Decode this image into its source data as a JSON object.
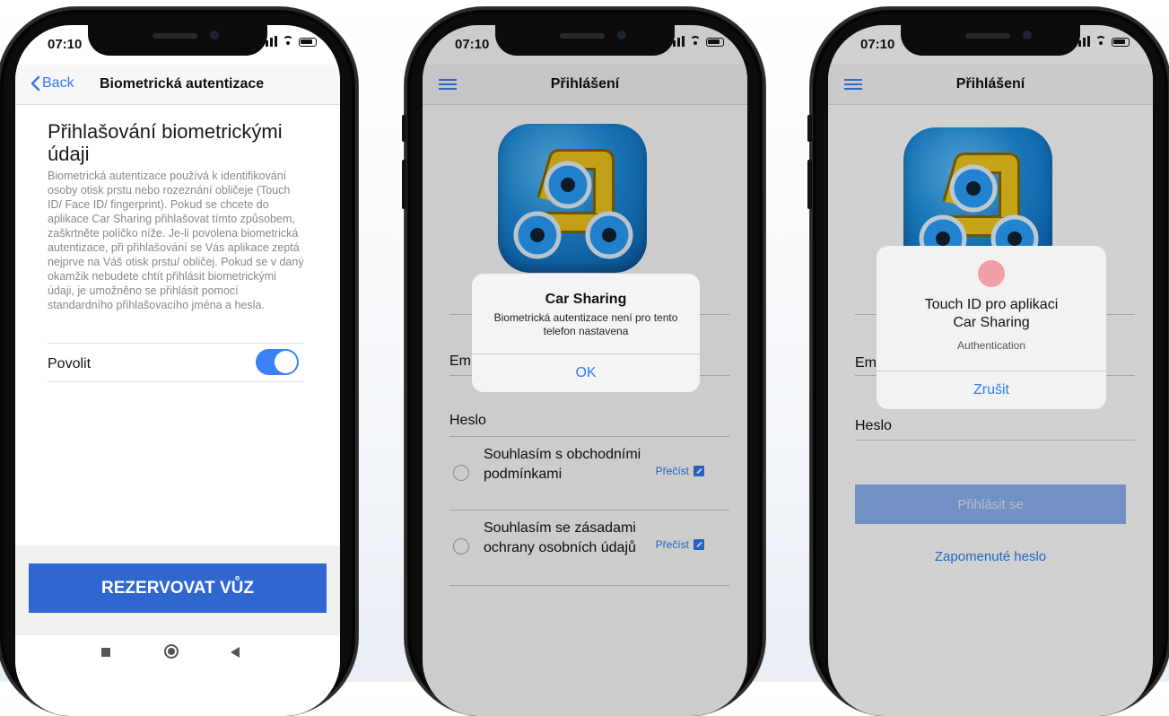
{
  "status": {
    "time": "07:10"
  },
  "phone1": {
    "back_label": "Back",
    "nav_title": "Biometrická autentizace",
    "heading": "Přihlašování biometrickými údaji",
    "description": "Biometrická autentizace používá k identifikování osoby otisk prstu nebo rozeznání obličeje (Touch ID/ Face ID/ fingerprint). Pokud se chcete do aplikace Car Sharing přihlašovat tímto způsobem, zaškrtněte políčko níže. Je-li povolena biometrická autentizace, při přihlašování se Vás aplikace zeptá nejprve na Váš otisk prstu/ obličej. Pokud se v daný okamžik nebudete chtít přihlásit biometrickými údaji, je umožněno se přihlásit pomocí standardního přihlašovacího jména a hesla.",
    "toggle_label": "Povolit",
    "toggle_on": true,
    "reserve_button": "REZERVOVAT VŮZ"
  },
  "phone2": {
    "nav_title": "Přihlášení",
    "email_label": "Em",
    "password_label": "Heslo",
    "terms_text": "Souhlasím s obchodními podmínkami",
    "privacy_text": "Souhlasím se zásadami ochrany osobních údajů",
    "read_label": "Přečíst",
    "alert": {
      "title": "Car Sharing",
      "message": "Biometrická autentizace není pro tento telefon nastavena",
      "button": "OK"
    }
  },
  "phone3": {
    "nav_title": "Přihlášení",
    "email_label": "Em",
    "password_label": "Heslo",
    "login_button": "Přihlásit se",
    "forgot_link": "Zapomenuté heslo",
    "alert": {
      "title": "Touch ID pro aplikaci Car Sharing",
      "subtitle": "Authentication",
      "button": "Zrušit"
    }
  },
  "colors": {
    "accent": "#2f7bf5",
    "primary_button": "#2f66cf",
    "logo_blue": "#1d8fe0",
    "logo_yellow": "#f2c81e"
  },
  "icons": [
    "chevron-left-icon",
    "hamburger-icon",
    "external-link-icon",
    "fingerprint-icon",
    "signal-icon",
    "wifi-icon",
    "battery-icon"
  ]
}
